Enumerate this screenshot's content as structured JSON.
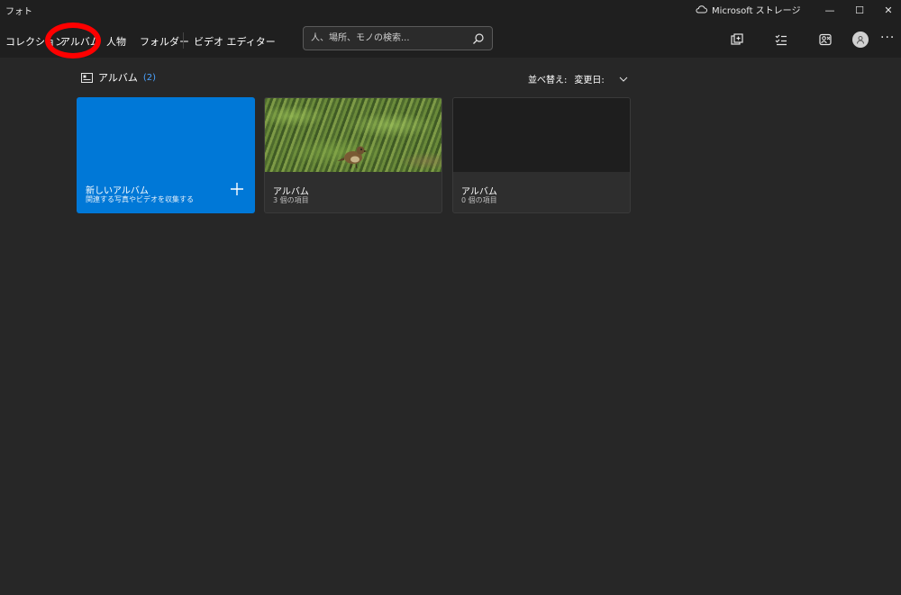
{
  "window": {
    "app_title": "フォト",
    "storage_label": "Microsoft ストレージ",
    "minimize_glyph": "—",
    "maximize_glyph": "☐",
    "close_glyph": "✕"
  },
  "nav": {
    "tabs": [
      {
        "label": "コレクション"
      },
      {
        "label": "アルバム"
      },
      {
        "label": "人物"
      },
      {
        "label": "フォルダー"
      },
      {
        "label": "ビデオ エディター"
      }
    ],
    "active_tab": "アルバム",
    "highlight_color": "#ff0000"
  },
  "search": {
    "placeholder": "人、場所、モノの検索..."
  },
  "toolbar": {
    "icons": [
      "import-icon",
      "select-icon",
      "people-icon",
      "account-icon",
      "more-icon"
    ],
    "more_label": "···"
  },
  "albums": {
    "heading": "アルバム",
    "count": "(2)",
    "sort_label": "並べ替え:",
    "sort_value": "変更日:",
    "new_album": {
      "title": "新しいアルバム",
      "subtitle": "関連する写真やビデオを収集する"
    },
    "items": [
      {
        "title": "アルバム",
        "subtitle": "3 個の項目"
      },
      {
        "title": "アルバム",
        "subtitle": "0 個の項目"
      }
    ]
  },
  "colors": {
    "accent": "#0078d7",
    "background": "#272727",
    "bar": "#1f1f1f",
    "count_text": "#4aa3ff"
  }
}
